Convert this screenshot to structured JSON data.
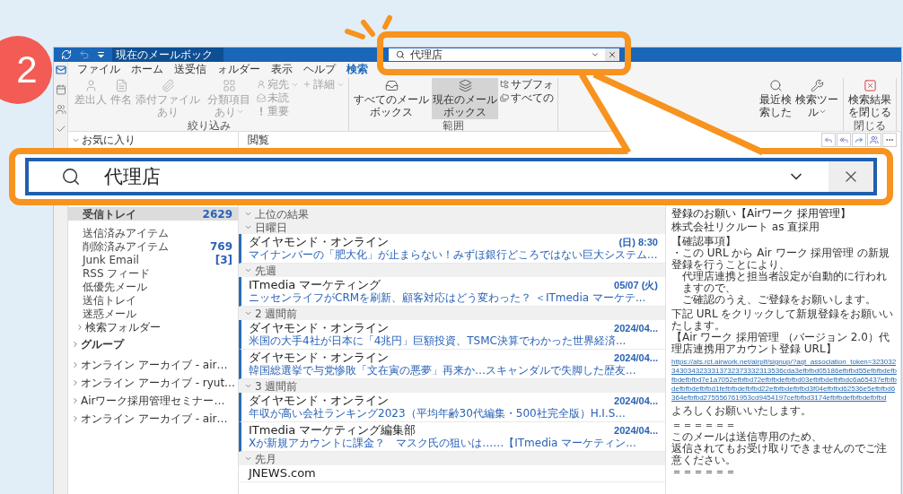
{
  "step": "2",
  "title_bar": {
    "scope": "現在のメールボック",
    "search": {
      "value": "代理店"
    }
  },
  "nav_rail": [
    {
      "kind": "mail",
      "selected": true
    },
    {
      "kind": "calendar",
      "selected": false
    },
    {
      "kind": "people",
      "selected": false
    },
    {
      "kind": "tasks",
      "selected": false
    }
  ],
  "tabs": [
    {
      "label": "ファイル",
      "selected": false
    },
    {
      "label": "ホーム",
      "selected": false
    },
    {
      "label": "送受信",
      "selected": false
    },
    {
      "label": "ォルダー",
      "selected": false
    },
    {
      "label": "表示",
      "selected": false
    },
    {
      "label": "ヘルプ",
      "selected": false
    },
    {
      "label": "検索",
      "selected": true
    }
  ],
  "ribbon": {
    "groups": [
      {
        "label": "絞り込み",
        "buttons": [
          {
            "label": "差出人",
            "kind": "large",
            "disabled": true,
            "dropdown": false
          },
          {
            "label": "件名",
            "kind": "large",
            "disabled": true,
            "dropdown": false
          },
          {
            "label": "添付ファイルあり",
            "kind": "large",
            "disabled": true,
            "dropdown": false
          },
          {
            "label": "分類項目あり",
            "kind": "large",
            "disabled": true,
            "dropdown": true
          },
          {
            "label": "宛先",
            "kind": "small",
            "disabled": true,
            "dropdown": true
          },
          {
            "label": "未読",
            "kind": "small",
            "disabled": true,
            "dropdown": false
          },
          {
            "label": "重要",
            "kind": "small",
            "disabled": true,
            "dropdown": false
          },
          {
            "label": "詳細",
            "kind": "small",
            "disabled": true,
            "dropdown": true
          }
        ]
      },
      {
        "label": "範囲",
        "buttons": [
          {
            "label": "すべてのメールボックス",
            "kind": "large",
            "disabled": false,
            "dropdown": false,
            "selected": false
          },
          {
            "label": "現在のメールボックス",
            "kind": "large",
            "disabled": false,
            "dropdown": false,
            "selected": true
          },
          {
            "label": "サブフォ",
            "kind": "small",
            "disabled": false,
            "dropdown": false,
            "selected": false
          },
          {
            "label": "すべての",
            "kind": "small",
            "disabled": false,
            "dropdown": false,
            "selected": false
          }
        ]
      },
      {
        "buttons": [
          {
            "label": "最近検索した",
            "kind": "large",
            "disabled": false,
            "dropdown": false
          },
          {
            "label": "検索ツール",
            "kind": "large",
            "disabled": false,
            "dropdown": true
          }
        ]
      },
      {
        "label": "閉じる",
        "buttons": [
          {
            "label": "検索結果を閉じる",
            "kind": "large",
            "disabled": false,
            "dropdown": false
          }
        ]
      }
    ]
  },
  "folder_pane": {
    "favorites": {
      "label": "お気に入り",
      "expanded": true,
      "items": [
        {
          "name": "受信トレイ",
          "count": "2629",
          "selected": true
        }
      ]
    },
    "folders": [
      {
        "name": "送信済みアイテム",
        "selected": false
      },
      {
        "name": "削除済みアイテム",
        "count": "769",
        "selected": false
      },
      {
        "name": "Junk Email",
        "count": "[3]",
        "selected": false
      },
      {
        "name": "RSS フィード",
        "selected": false
      },
      {
        "name": "低優先メール",
        "selected": false
      },
      {
        "name": "送信トレイ",
        "selected": false
      },
      {
        "name": "迷惑メール",
        "selected": false
      }
    ],
    "sections": [
      {
        "label": "検索フォルダー",
        "kind": "folder",
        "expanded": false
      },
      {
        "label": "グループ",
        "kind": "group",
        "expanded": false
      },
      {
        "label": "オンライン アーカイブ - air…",
        "kind": "account",
        "expanded": false
      },
      {
        "label": "オンライン アーカイブ - ryut…",
        "kind": "account",
        "expanded": false
      },
      {
        "label": "Airワーク採用管理セミナー…",
        "kind": "account",
        "expanded": false
      },
      {
        "label": "オンライン アーカイブ - air…",
        "kind": "account",
        "expanded": false
      }
    ]
  },
  "message_list": {
    "heading": "閲覧",
    "groups": [
      {
        "label": "上位の結果",
        "expanded": true
      },
      {
        "label": "日曜日",
        "expanded": true,
        "messages": [
          {
            "sender": "ダイヤモンド・オンライン",
            "preview": "マイナンバーの「肥大化」が止まらない！みずほ銀行どころではない巨大システム...",
            "date": "(日) 8:30",
            "unread": true
          }
        ]
      },
      {
        "label": "先週",
        "expanded": true,
        "messages": [
          {
            "sender": "ITmedia マーケティング",
            "preview": "ニッセンライフがCRMを刷新、顧客対応はどう変わった？ ＜ITmedia マーケテ...",
            "date": "05/07 (火)",
            "unread": true
          }
        ]
      },
      {
        "label": "2 週間前",
        "expanded": true,
        "messages": [
          {
            "sender": "ダイヤモンド・オンライン",
            "preview": "米国の大手4社が日本に「4兆円」巨額投資、TSMC決算でわかった世界経済...",
            "date": "2024/04...",
            "unread": true
          },
          {
            "sender": "ダイヤモンド・オンライン",
            "preview": "韓国総選挙で与党惨敗「文在寅の悪夢」再来か…スキャンダルで失脚した歴友...",
            "date": "2024/04...",
            "unread": true
          }
        ]
      },
      {
        "label": "3 週間前",
        "expanded": true,
        "messages": [
          {
            "sender": "ダイヤモンド・オンライン",
            "preview": "年収が高い会社ランキング2023（平均年齢30代編集・500社完全版）H.I.S...",
            "date": "2024/04...",
            "unread": true
          },
          {
            "sender": "ITmedia マーケティング編集部",
            "preview": "Xが新規アカウントに課金？　マスク氏の狙いは……【ITmedia マーケティン...",
            "date": "2024/04...",
            "unread": true
          }
        ]
      },
      {
        "label": "先月",
        "expanded": true,
        "messages": [
          {
            "sender": "JNEWS.com",
            "unread": false
          }
        ]
      }
    ]
  },
  "reading_pane": {
    "subject": "登録のお願い【Airワーク 採用管理】",
    "body": [
      {
        "kind": "text",
        "lines": [
          {
            "text": "株式会社リクルート as 直採用",
            "indent": false
          }
        ]
      },
      {
        "kind": "text",
        "lines": [
          {
            "text": "【確認事項】",
            "indent": false
          },
          {
            "text": "・この URL から Air ワーク 採用管理 の新規登録を行うことにより、",
            "indent": false
          },
          {
            "text": "代理店連携と担当者設定が自動的に行われますので、",
            "indent": true
          },
          {
            "text": "ご確認のうえ、ご登録をお願いします。",
            "indent": true
          }
        ]
      },
      {
        "kind": "text",
        "lines": [
          {
            "text": "下記 URL をクリックして新規登録をお願いいたします。",
            "indent": false
          },
          {
            "text": "【Air ワーク 採用管理 （バージョン 2.0）代理店連携用アカウント登録 URL】",
            "indent": false
          }
        ]
      },
      {
        "kind": "link",
        "text": "https://ats.rct.airwork.net/airplf/signup/?agt_association_token=3230323430343233313732373332313536cda3efbfbd05186efbfbd55efbfbdefbfbdefbfbd7e1a7052efbfbd72efbfbdefbfbd03efbfbdefbfbdc6a65437efbfbdefbfbdefbfbd1fefbfbdefbfbd22efbfbdefbfbd3f04efbfbd62536e5efbfbd6364efbfbd275556761953cd9454197cefbfbd3174efbfbdefbfbdefbfbd"
      },
      {
        "kind": "text",
        "lines": [
          {
            "text": "よろしくお願いいたします。",
            "indent": false
          }
        ]
      },
      {
        "kind": "text",
        "lines": [
          {
            "text": "＝＝＝＝＝＝",
            "indent": false
          },
          {
            "text": "このメールは送信専用のため、",
            "indent": false
          },
          {
            "text": "返信されてもお受け取りできませんのでご注意ください。",
            "indent": false
          },
          {
            "text": "＝＝＝＝＝＝",
            "indent": false
          }
        ]
      }
    ]
  },
  "callout": {
    "search": {
      "value": "代理店"
    }
  }
}
